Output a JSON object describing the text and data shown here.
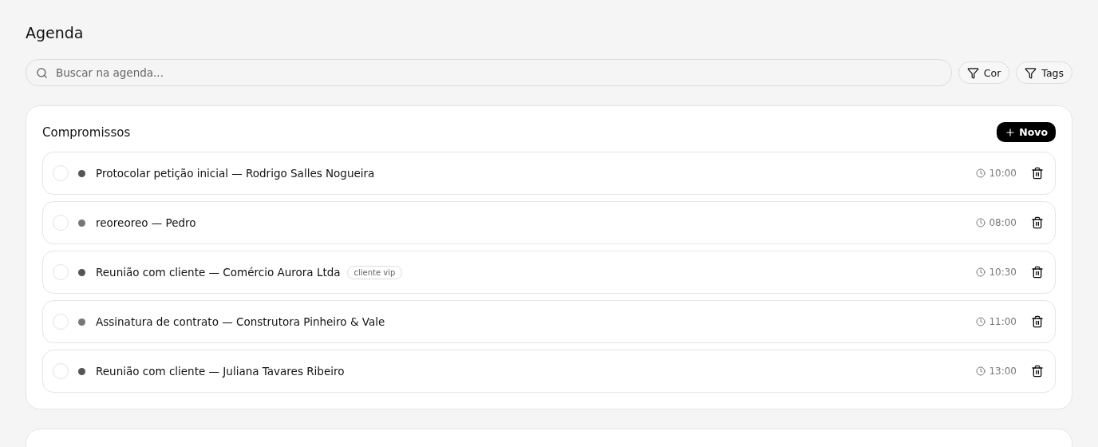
{
  "page": {
    "title": "Agenda"
  },
  "search": {
    "placeholder": "Buscar na agenda..."
  },
  "filters": [
    "Cor",
    "Tags"
  ],
  "appointments": {
    "title": "Compromissos",
    "new_button": "Novo",
    "items": [
      {
        "title": "Protocolar petição inicial — Rodrigo Salles Nogueira",
        "color": "#555555",
        "done": false,
        "time": "10:00"
      },
      {
        "title": "reoreoreo — Pedro",
        "color": "#777777",
        "done": false,
        "time": "08:00"
      },
      {
        "title": "Reunião com cliente — Comércio Aurora Ltda",
        "color": "#555555",
        "done": false,
        "time": "10:30",
        "tags": [
          "cliente vip"
        ]
      },
      {
        "title": "Assinatura de contrato — Construtora Pinheiro & Vale",
        "color": "#777777",
        "done": false,
        "time": "11:00"
      },
      {
        "title": "Reunião com cliente — Juliana Tavares Ribeiro",
        "color": "#555555",
        "done": false,
        "time": "13:00"
      }
    ]
  }
}
